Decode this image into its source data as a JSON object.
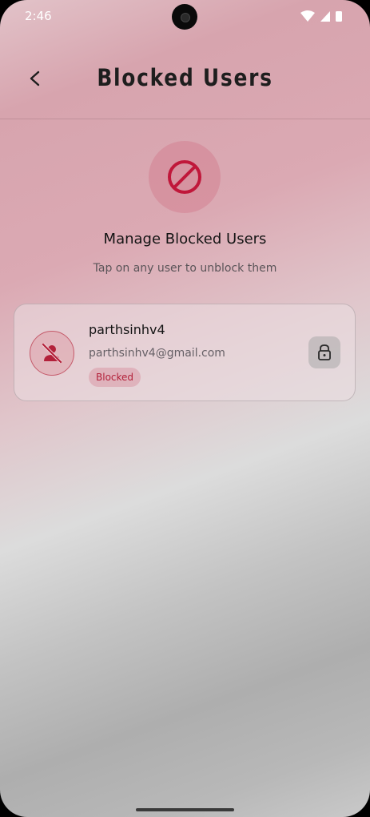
{
  "status_bar": {
    "time": "2:46",
    "icons": [
      "wifi-icon",
      "signal-icon",
      "battery-icon"
    ]
  },
  "header": {
    "title": "Blocked Users",
    "back_icon": "chevron-left-icon"
  },
  "hero": {
    "icon": "block-icon",
    "title": "Manage Blocked Users",
    "subtitle": "Tap on any user to unblock them"
  },
  "blocked_users": [
    {
      "username": "parthsinhv4",
      "email": "parthsinhv4@gmail.com",
      "status": "Blocked",
      "avatar_icon": "person-off-icon",
      "action_icon": "unlock-icon"
    }
  ],
  "colors": {
    "accent": "#c0173a",
    "badge_text": "#b3213a",
    "gradient_top": "#d7a4ae",
    "gradient_bottom": "#aeaeae"
  }
}
